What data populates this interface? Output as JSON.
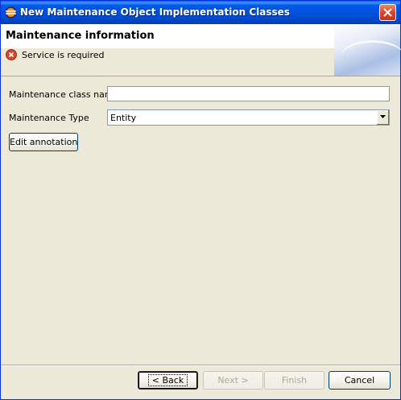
{
  "window": {
    "title": "New Maintenance Object Implementation Classes"
  },
  "header": {
    "title": "Maintenance information",
    "message": "Service is required",
    "message_icon": "error-icon"
  },
  "form": {
    "class_name_label": "Maintenance class name",
    "class_name_value": "",
    "type_label": "Maintenance Type",
    "type_value": "Entity",
    "edit_annotation_label": "Edit annotation"
  },
  "footer": {
    "back_label": "< Back",
    "next_label": "Next >",
    "finish_label": "Finish",
    "cancel_label": "Cancel"
  }
}
